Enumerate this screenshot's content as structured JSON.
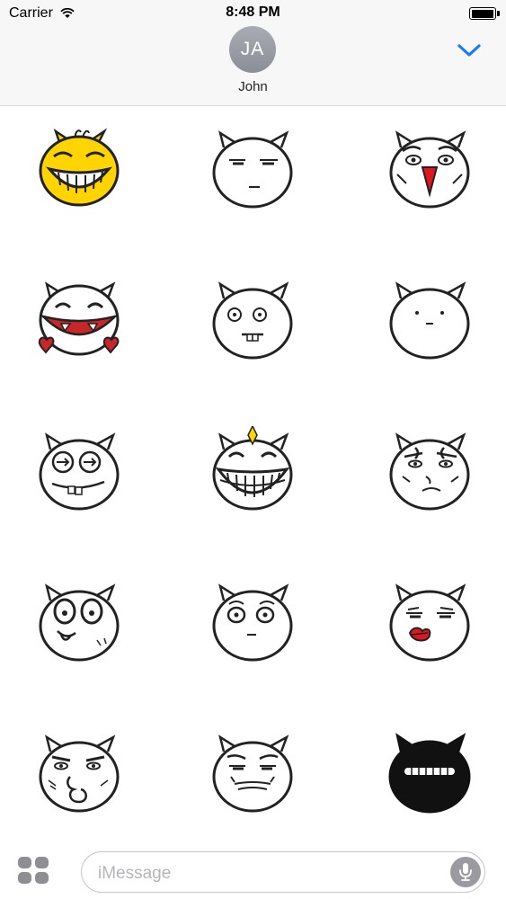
{
  "status_bar": {
    "carrier": "Carrier",
    "time": "8:48 PM",
    "battery_level": 1.0
  },
  "header": {
    "avatar_initials": "JA",
    "contact_name": "John",
    "collapse_icon": "chevron-down-icon",
    "accent_color": "#1a7cf5"
  },
  "stickers": [
    {
      "name": "laughing-yellow"
    },
    {
      "name": "unimpressed"
    },
    {
      "name": "nosebleed-sad"
    },
    {
      "name": "hearts-big-grin"
    },
    {
      "name": "derp-buck-teeth"
    },
    {
      "name": "blank-face"
    },
    {
      "name": "arrow-eyes"
    },
    {
      "name": "sparkle-grin"
    },
    {
      "name": "frowning-skeptical"
    },
    {
      "name": "shocked-tongue"
    },
    {
      "name": "startled"
    },
    {
      "name": "red-lips-sleepy"
    },
    {
      "name": "chin-pout"
    },
    {
      "name": "tired-meh"
    },
    {
      "name": "black-grin"
    }
  ],
  "compose": {
    "apps_icon": "apps-icon",
    "placeholder": "iMessage",
    "mic_icon": "microphone-icon"
  }
}
